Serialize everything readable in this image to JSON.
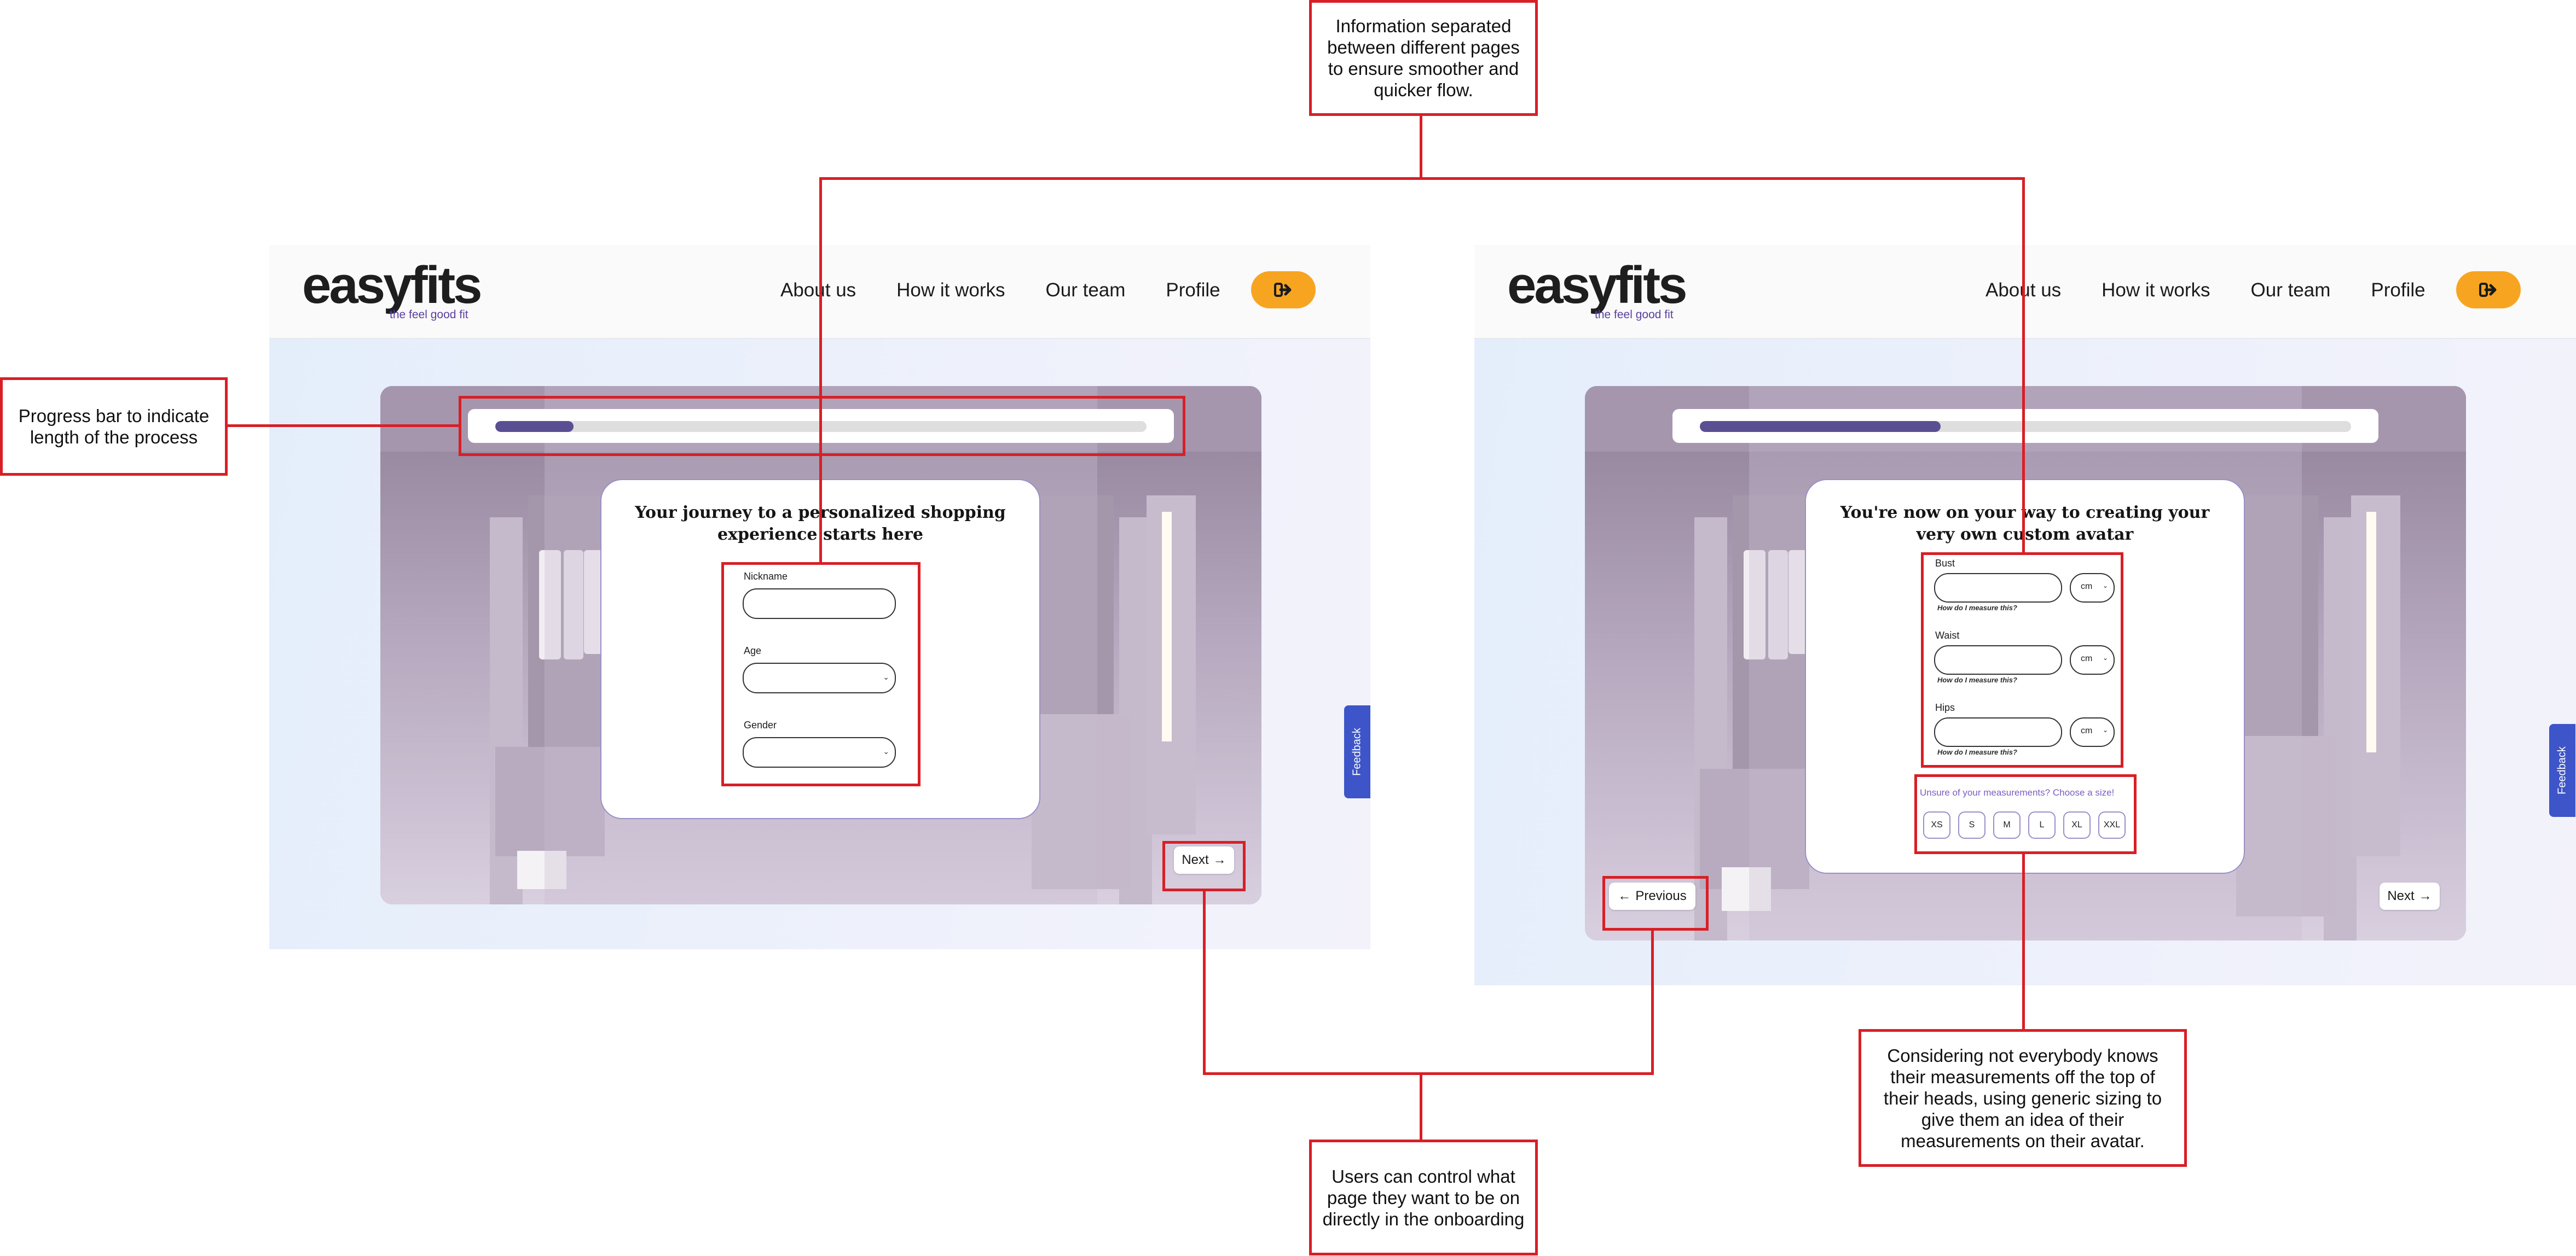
{
  "colors": {
    "accent": "#f7a521",
    "brand_purple": "#5b4f93",
    "annotation_red": "#d81f26",
    "feedback_blue": "#3d55c8"
  },
  "screen_1": {
    "logo": {
      "word": "easyfits",
      "tagline": "the feel good fit"
    },
    "nav": [
      "About us",
      "How it works",
      "Our team",
      "Profile"
    ],
    "logout_icon": "sign-out-icon",
    "progress": 0.12,
    "title": "Your journey to a personalized shopping experience starts here",
    "fields": {
      "nickname_label": "Nickname",
      "age_label": "Age",
      "gender_label": "Gender"
    },
    "next_label": "Next",
    "feedback_label": "Feedback"
  },
  "screen_2": {
    "logo": {
      "word": "easyfits",
      "tagline": "the feel good fit"
    },
    "nav": [
      "About us",
      "How it works",
      "Our team",
      "Profile"
    ],
    "logout_icon": "sign-out-icon",
    "progress": 0.37,
    "title": "You're now on your way to creating your very own custom avatar",
    "measurements": [
      {
        "label": "Bust",
        "unit": "cm",
        "help": "How do I measure this?"
      },
      {
        "label": "Waist",
        "unit": "cm",
        "help": "How do I measure this?"
      },
      {
        "label": "Hips",
        "unit": "cm",
        "help": "How do I measure this?"
      }
    ],
    "unsure_text": "Unsure of your measurements? Choose a size!",
    "sizes": [
      "XS",
      "S",
      "M",
      "L",
      "XL",
      "XXL"
    ],
    "previous_label": "Previous",
    "next_label": "Next",
    "feedback_label": "Feedback"
  },
  "annotations": {
    "pages": "Information separated between different pages to ensure smoother and quicker flow.",
    "progress": "Progress bar to indicate length of the process",
    "navigation": "Users can control what page they want to be on directly in the onboarding",
    "sizing": "Considering not everybody knows their measurements off the top of their heads, using generic sizing to give them an idea of their measurements on their avatar."
  }
}
